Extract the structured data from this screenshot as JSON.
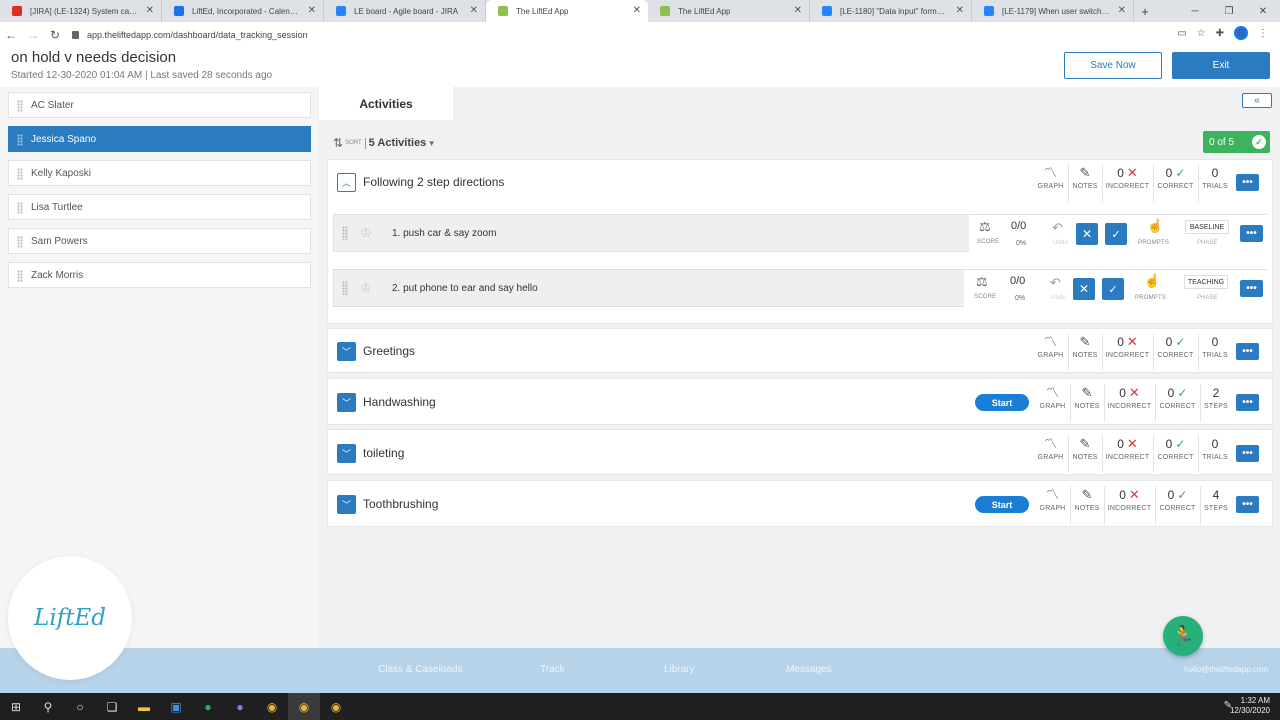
{
  "browser": {
    "tabs": [
      {
        "title": "[JIRA] (LE-1324) System can't sa",
        "color": "#d93025"
      },
      {
        "title": "LiftEd, Incorporated - Calendar -",
        "color": "#1a73e8"
      },
      {
        "title": "LE board - Agile board - JIRA",
        "color": "#2684ff"
      },
      {
        "title": "The LiftEd App",
        "color": "#8fbf4c"
      },
      {
        "title": "The LiftEd App",
        "color": "#8fbf4c"
      },
      {
        "title": "[LE-1180] \"Data input\" format a",
        "color": "#2684ff"
      },
      {
        "title": "[LE-1179] When user switching T",
        "color": "#2684ff"
      }
    ],
    "url": "app.theliftedapp.com/dashboard/data_tracking_session",
    "profile_initial": "B"
  },
  "header": {
    "title": "on hold v needs decision",
    "subtitle": "Started 12-30-2020 01:04 AM | Last saved 28 seconds ago",
    "save_label": "Save Now",
    "exit_label": "Exit"
  },
  "students": [
    {
      "name": "AC Slater",
      "active": false
    },
    {
      "name": "Jessica Spano",
      "active": true
    },
    {
      "name": "Kelly Kaposki",
      "active": false
    },
    {
      "name": "Lisa Turtlee",
      "active": false
    },
    {
      "name": "Sam Powers",
      "active": false
    },
    {
      "name": "Zack Morris",
      "active": false
    }
  ],
  "logo_text": "LiftEd",
  "main": {
    "tab_label": "Activities",
    "collapse_icon": "«",
    "sort_label": "SORT",
    "activity_count": "5 Activities",
    "progress": "0 of 5"
  },
  "labels": {
    "graph": "GRAPH",
    "notes": "NOTES",
    "incorrect": "INCORRECT",
    "correct": "CORRECT",
    "trials": "TRIALS",
    "steps": "STEPS",
    "score": "SCORE",
    "undo": "Undo",
    "prompts": "PROMPTS",
    "phase": "PHASE",
    "start": "Start"
  },
  "activities": [
    {
      "name": "Following 2 step directions",
      "incorrect": "0",
      "correct": "0",
      "count": "0",
      "count_label": "TRIALS",
      "expanded": true
    },
    {
      "name": "Greetings",
      "incorrect": "0",
      "correct": "0",
      "count": "0",
      "count_label": "TRIALS"
    },
    {
      "name": "Handwashing",
      "incorrect": "0",
      "correct": "0",
      "count": "2",
      "count_label": "STEPS",
      "start": true
    },
    {
      "name": "toileting",
      "incorrect": "0",
      "correct": "0",
      "count": "0",
      "count_label": "TRIALS"
    },
    {
      "name": "Toothbrushing",
      "incorrect": "0",
      "correct": "0",
      "count": "4",
      "count_label": "STEPS",
      "start": true
    }
  ],
  "targets": [
    {
      "name": "1. push car & say zoom",
      "score": "0/0",
      "pct": "0%",
      "phase": "BASELINE"
    },
    {
      "name": "2. put phone to ear and say hello",
      "score": "0/0",
      "pct": "0%",
      "phase": "TEACHING"
    }
  ],
  "footer": {
    "nav": [
      "Class & Caseloads",
      "Track",
      "Library",
      "Messages"
    ],
    "email": "hello@theliftedapp.com"
  },
  "taskbar": {
    "time": "1:32 AM",
    "date": "12/30/2020"
  },
  "colors": {
    "primary": "#2b7bc0",
    "success": "#3db35e",
    "error": "#d9333f",
    "fab": "#27b07a"
  }
}
